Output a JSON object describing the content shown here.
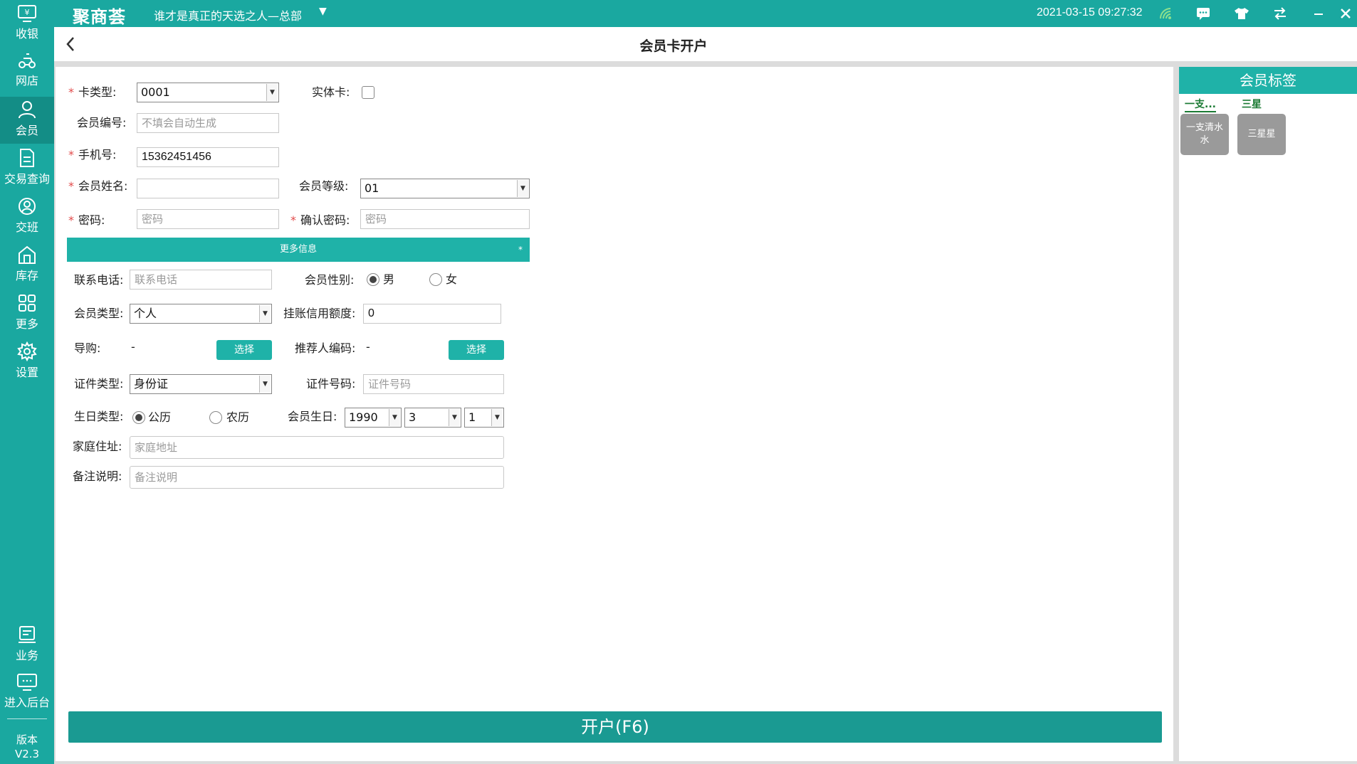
{
  "topbar": {
    "logo": "聚商荟",
    "store_name": "谁才是真正的天选之人—总部",
    "datetime": "2021-03-15 09:27:32"
  },
  "sidebar": {
    "items": [
      {
        "label": "收银",
        "icon": "cashier-icon"
      },
      {
        "label": "网店",
        "icon": "online-store-icon"
      },
      {
        "label": "会员",
        "icon": "member-icon",
        "active": true
      },
      {
        "label": "交易查询",
        "icon": "transaction-query-icon"
      },
      {
        "label": "交班",
        "icon": "shift-handover-icon"
      },
      {
        "label": "库存",
        "icon": "inventory-icon"
      },
      {
        "label": "更多",
        "icon": "more-grid-icon"
      },
      {
        "label": "设置",
        "icon": "settings-gear-icon"
      },
      {
        "label": "业务",
        "icon": "business-icon"
      },
      {
        "label": "进入后台",
        "icon": "backend-monitor-icon"
      }
    ],
    "version_label": "版本",
    "version_value": "V2.3"
  },
  "page": {
    "title": "会员卡开户"
  },
  "form": {
    "card_type_label": "卡类型:",
    "card_type_value": "0001",
    "physical_card_label": "实体卡:",
    "member_no_label": "会员编号:",
    "member_no_placeholder": "不填会自动生成",
    "phone_label": "手机号:",
    "phone_value": "15362451456",
    "member_name_label": "会员姓名:",
    "member_level_label": "会员等级:",
    "member_level_value": "01",
    "password_label": "密码:",
    "password_placeholder": "密码",
    "confirm_password_label": "确认密码:",
    "confirm_password_placeholder": "密码",
    "more_info_label": "更多信息",
    "more_info_caret": "*",
    "contact_phone_label": "联系电话:",
    "contact_phone_placeholder": "联系电话",
    "gender_label": "会员性别:",
    "gender_male": "男",
    "gender_female": "女",
    "member_type_label": "会员类型:",
    "member_type_value": "个人",
    "credit_limit_label": "挂账信用额度:",
    "credit_limit_value": "0",
    "guide_label": "导购:",
    "guide_value": "-",
    "select_button": "选择",
    "referrer_label": "推荐人编码:",
    "referrer_value": "-",
    "id_type_label": "证件类型:",
    "id_type_value": "身份证",
    "id_no_label": "证件号码:",
    "id_no_placeholder": "证件号码",
    "birthday_type_label": "生日类型:",
    "birthday_solar": "公历",
    "birthday_lunar": "农历",
    "birthday_label": "会员生日:",
    "birth_year": "1990",
    "birth_month": "3",
    "birth_day": "1",
    "address_label": "家庭住址:",
    "address_placeholder": "家庭地址",
    "remark_label": "备注说明:",
    "remark_placeholder": "备注说明",
    "submit_button": "开户(F6)"
  },
  "tags": {
    "header": "会员标签",
    "categories": [
      "一支...",
      "三星"
    ],
    "chips": [
      "一支清水水",
      "三星星"
    ]
  }
}
